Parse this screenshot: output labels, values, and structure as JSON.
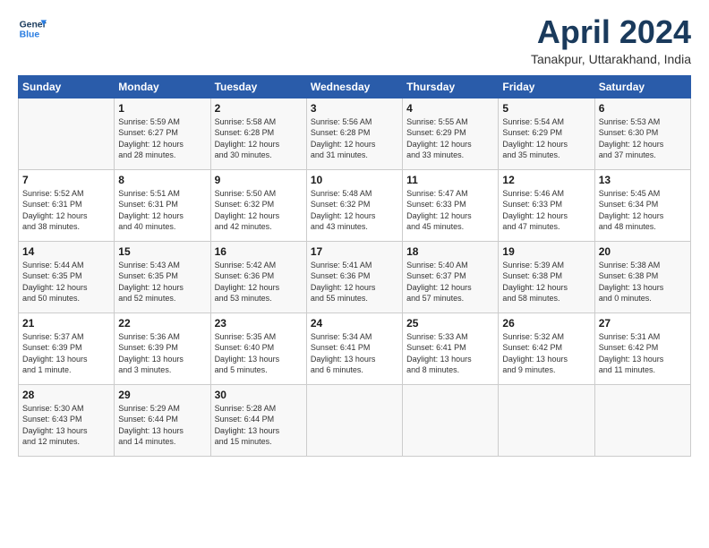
{
  "logo": {
    "line1": "General",
    "line2": "Blue"
  },
  "title": "April 2024",
  "location": "Tanakpur, Uttarakhand, India",
  "weekdays": [
    "Sunday",
    "Monday",
    "Tuesday",
    "Wednesday",
    "Thursday",
    "Friday",
    "Saturday"
  ],
  "weeks": [
    [
      {
        "day": "",
        "info": ""
      },
      {
        "day": "1",
        "info": "Sunrise: 5:59 AM\nSunset: 6:27 PM\nDaylight: 12 hours\nand 28 minutes."
      },
      {
        "day": "2",
        "info": "Sunrise: 5:58 AM\nSunset: 6:28 PM\nDaylight: 12 hours\nand 30 minutes."
      },
      {
        "day": "3",
        "info": "Sunrise: 5:56 AM\nSunset: 6:28 PM\nDaylight: 12 hours\nand 31 minutes."
      },
      {
        "day": "4",
        "info": "Sunrise: 5:55 AM\nSunset: 6:29 PM\nDaylight: 12 hours\nand 33 minutes."
      },
      {
        "day": "5",
        "info": "Sunrise: 5:54 AM\nSunset: 6:29 PM\nDaylight: 12 hours\nand 35 minutes."
      },
      {
        "day": "6",
        "info": "Sunrise: 5:53 AM\nSunset: 6:30 PM\nDaylight: 12 hours\nand 37 minutes."
      }
    ],
    [
      {
        "day": "7",
        "info": "Sunrise: 5:52 AM\nSunset: 6:31 PM\nDaylight: 12 hours\nand 38 minutes."
      },
      {
        "day": "8",
        "info": "Sunrise: 5:51 AM\nSunset: 6:31 PM\nDaylight: 12 hours\nand 40 minutes."
      },
      {
        "day": "9",
        "info": "Sunrise: 5:50 AM\nSunset: 6:32 PM\nDaylight: 12 hours\nand 42 minutes."
      },
      {
        "day": "10",
        "info": "Sunrise: 5:48 AM\nSunset: 6:32 PM\nDaylight: 12 hours\nand 43 minutes."
      },
      {
        "day": "11",
        "info": "Sunrise: 5:47 AM\nSunset: 6:33 PM\nDaylight: 12 hours\nand 45 minutes."
      },
      {
        "day": "12",
        "info": "Sunrise: 5:46 AM\nSunset: 6:33 PM\nDaylight: 12 hours\nand 47 minutes."
      },
      {
        "day": "13",
        "info": "Sunrise: 5:45 AM\nSunset: 6:34 PM\nDaylight: 12 hours\nand 48 minutes."
      }
    ],
    [
      {
        "day": "14",
        "info": "Sunrise: 5:44 AM\nSunset: 6:35 PM\nDaylight: 12 hours\nand 50 minutes."
      },
      {
        "day": "15",
        "info": "Sunrise: 5:43 AM\nSunset: 6:35 PM\nDaylight: 12 hours\nand 52 minutes."
      },
      {
        "day": "16",
        "info": "Sunrise: 5:42 AM\nSunset: 6:36 PM\nDaylight: 12 hours\nand 53 minutes."
      },
      {
        "day": "17",
        "info": "Sunrise: 5:41 AM\nSunset: 6:36 PM\nDaylight: 12 hours\nand 55 minutes."
      },
      {
        "day": "18",
        "info": "Sunrise: 5:40 AM\nSunset: 6:37 PM\nDaylight: 12 hours\nand 57 minutes."
      },
      {
        "day": "19",
        "info": "Sunrise: 5:39 AM\nSunset: 6:38 PM\nDaylight: 12 hours\nand 58 minutes."
      },
      {
        "day": "20",
        "info": "Sunrise: 5:38 AM\nSunset: 6:38 PM\nDaylight: 13 hours\nand 0 minutes."
      }
    ],
    [
      {
        "day": "21",
        "info": "Sunrise: 5:37 AM\nSunset: 6:39 PM\nDaylight: 13 hours\nand 1 minute."
      },
      {
        "day": "22",
        "info": "Sunrise: 5:36 AM\nSunset: 6:39 PM\nDaylight: 13 hours\nand 3 minutes."
      },
      {
        "day": "23",
        "info": "Sunrise: 5:35 AM\nSunset: 6:40 PM\nDaylight: 13 hours\nand 5 minutes."
      },
      {
        "day": "24",
        "info": "Sunrise: 5:34 AM\nSunset: 6:41 PM\nDaylight: 13 hours\nand 6 minutes."
      },
      {
        "day": "25",
        "info": "Sunrise: 5:33 AM\nSunset: 6:41 PM\nDaylight: 13 hours\nand 8 minutes."
      },
      {
        "day": "26",
        "info": "Sunrise: 5:32 AM\nSunset: 6:42 PM\nDaylight: 13 hours\nand 9 minutes."
      },
      {
        "day": "27",
        "info": "Sunrise: 5:31 AM\nSunset: 6:42 PM\nDaylight: 13 hours\nand 11 minutes."
      }
    ],
    [
      {
        "day": "28",
        "info": "Sunrise: 5:30 AM\nSunset: 6:43 PM\nDaylight: 13 hours\nand 12 minutes."
      },
      {
        "day": "29",
        "info": "Sunrise: 5:29 AM\nSunset: 6:44 PM\nDaylight: 13 hours\nand 14 minutes."
      },
      {
        "day": "30",
        "info": "Sunrise: 5:28 AM\nSunset: 6:44 PM\nDaylight: 13 hours\nand 15 minutes."
      },
      {
        "day": "",
        "info": ""
      },
      {
        "day": "",
        "info": ""
      },
      {
        "day": "",
        "info": ""
      },
      {
        "day": "",
        "info": ""
      }
    ]
  ]
}
